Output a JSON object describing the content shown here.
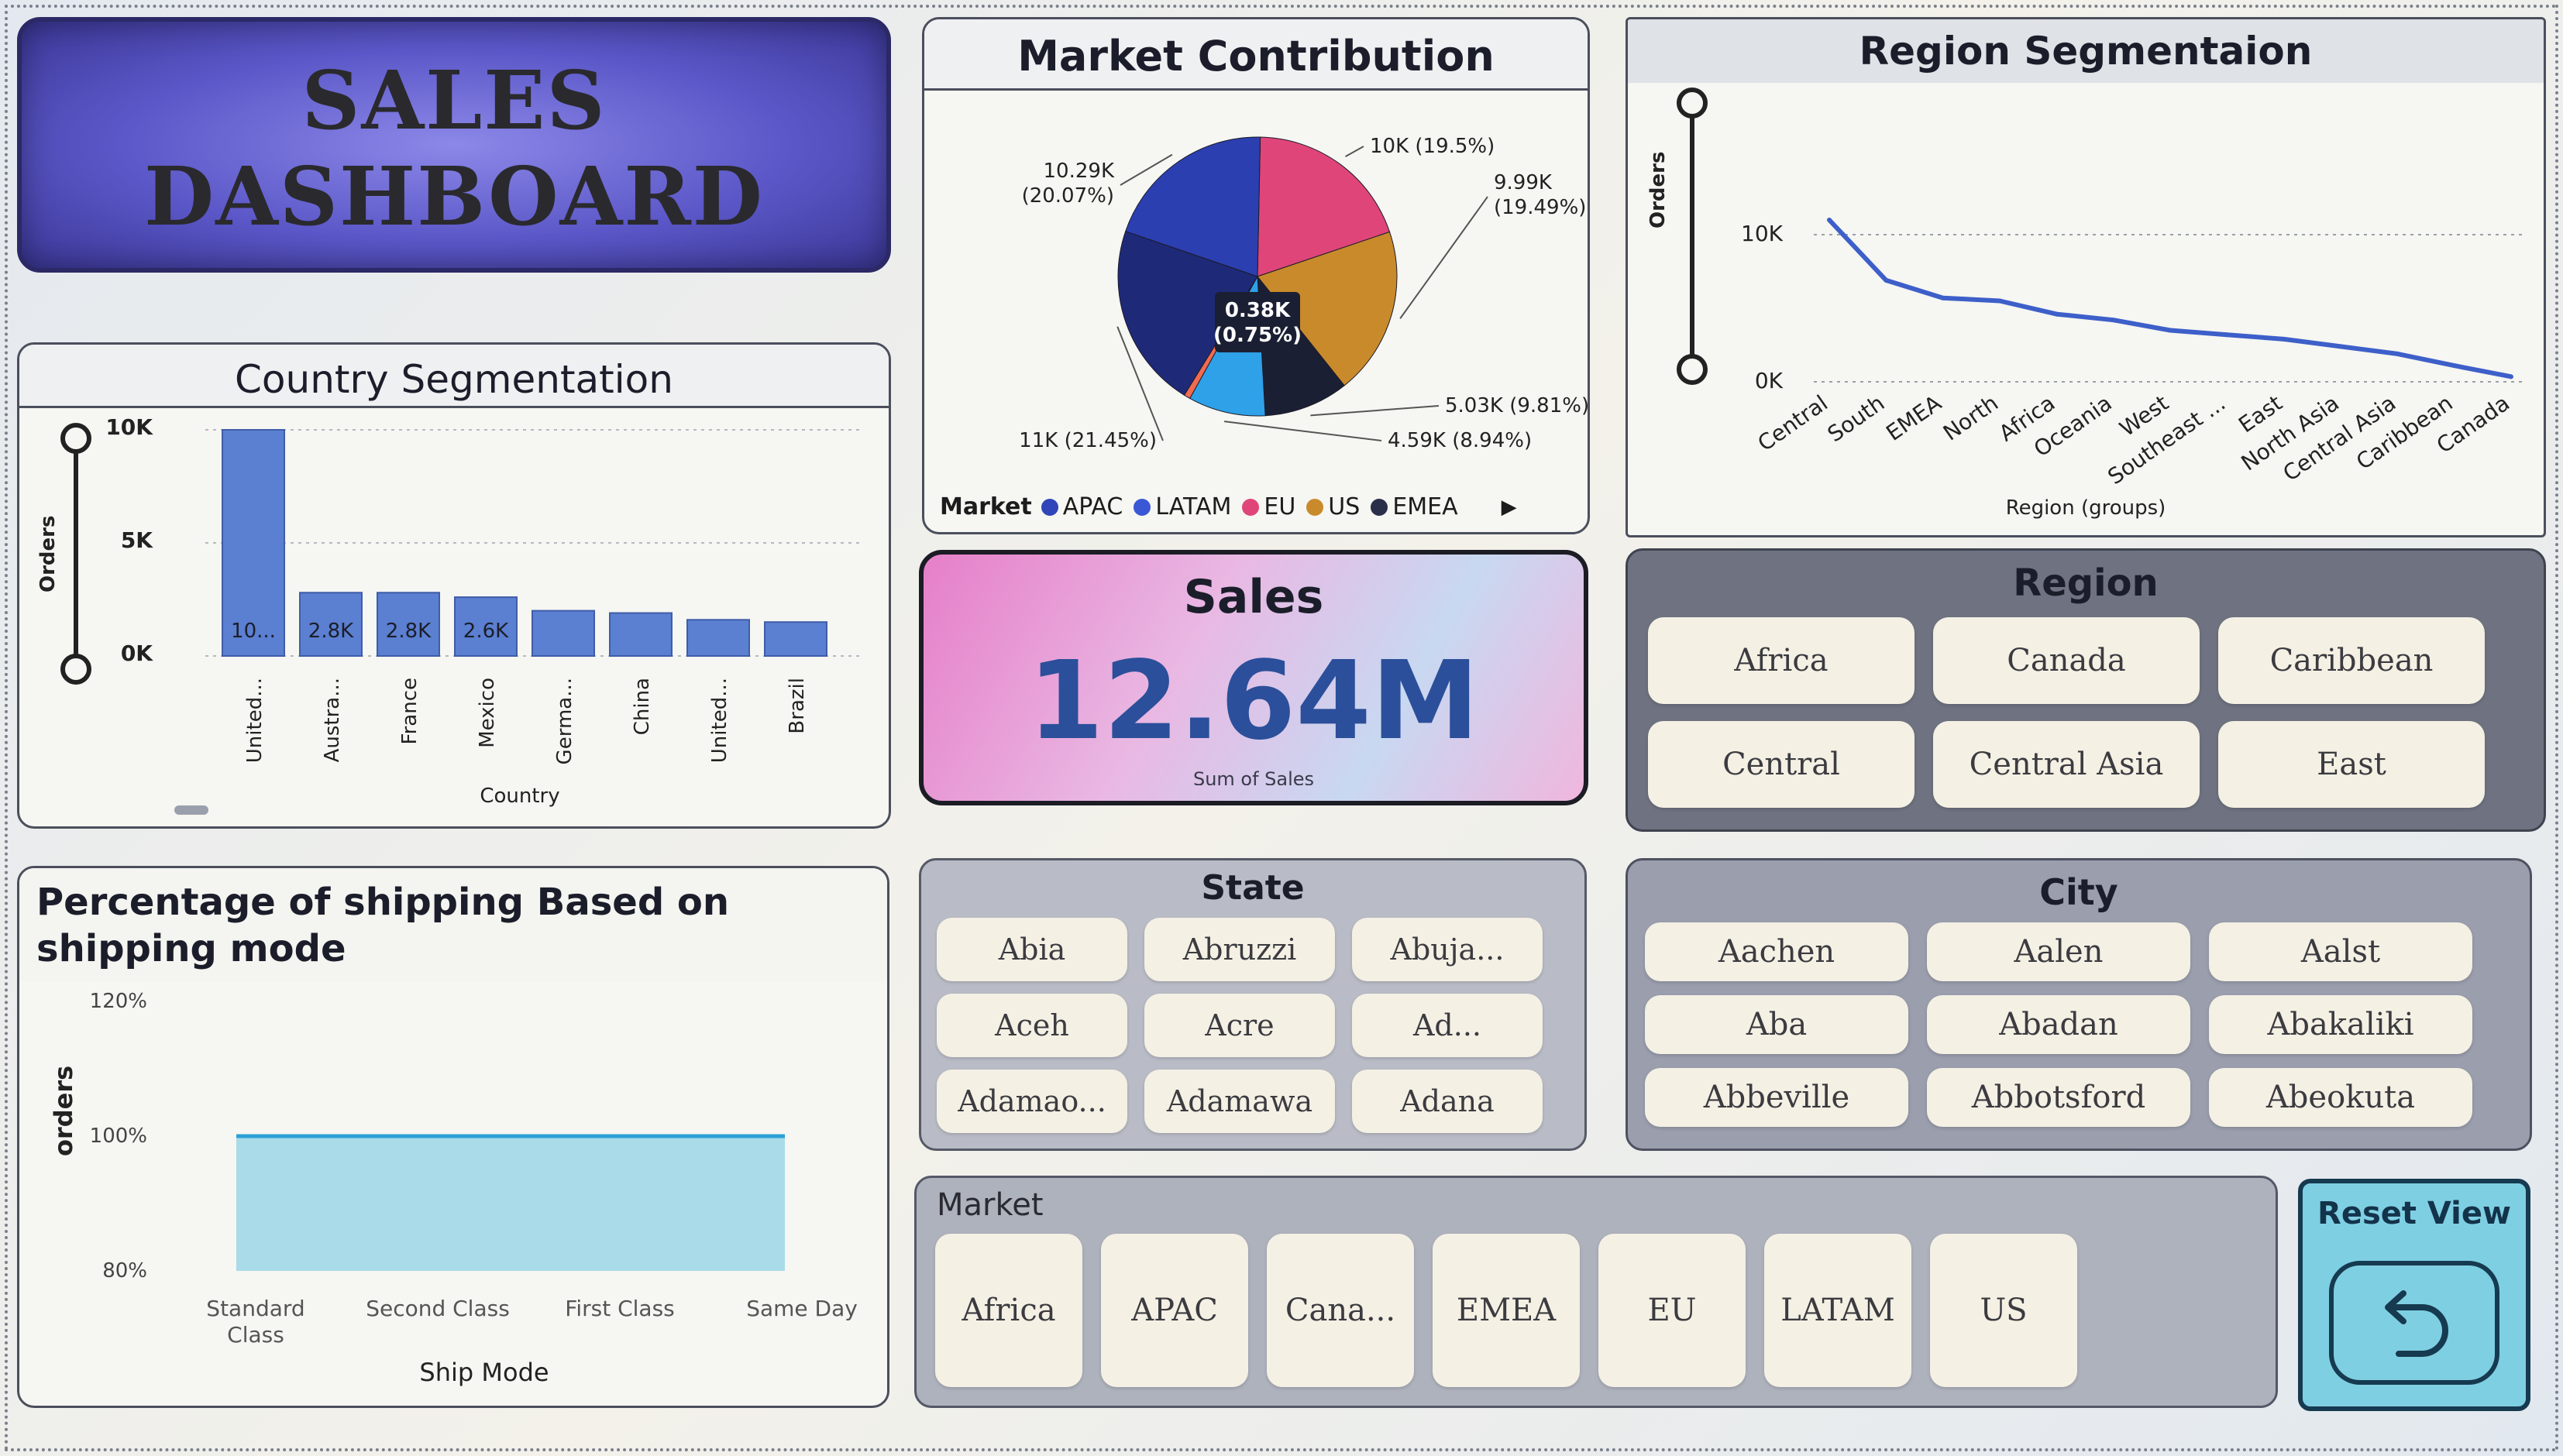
{
  "title": {
    "line1": "SALES",
    "line2": "DASHBOARD"
  },
  "market_contribution": {
    "title": "Market Contribution",
    "legend_title": "Market",
    "legend": [
      {
        "name": "APAC",
        "color": "#2f45b8"
      },
      {
        "name": "LATAM",
        "color": "#3a57d6"
      },
      {
        "name": "EU",
        "color": "#e0457a"
      },
      {
        "name": "US",
        "color": "#c98a2b"
      },
      {
        "name": "EMEA",
        "color": "#2a2f4a"
      }
    ],
    "slices": [
      {
        "label": "10K (19.5%)",
        "value": 10,
        "color": "#e0457a"
      },
      {
        "label": "9.99K (19.49%)",
        "value": 9.99,
        "color": "#c98a2b"
      },
      {
        "label": "5.03K (9.81%)",
        "value": 5.03,
        "color": "#1b1f33"
      },
      {
        "label": "4.59K (8.94%)",
        "value": 4.59,
        "color": "#2ea1e8"
      },
      {
        "label": "0.38K (0.75%)",
        "value": 0.38,
        "color": "#f26a4f"
      },
      {
        "label": "11K (21.45%)",
        "value": 11,
        "color": "#1e2a78"
      },
      {
        "label": "10.29K (20.07%)",
        "value": 10.29,
        "color": "#2b3fb0"
      }
    ],
    "center_label": "0.38K\n(0.75%)"
  },
  "region_segmentation": {
    "title": "Region Segmentaion",
    "ylabel": "Orders",
    "xlabel": "Region (groups)",
    "yticks": [
      "10K",
      "0K"
    ],
    "categories": [
      "Central",
      "South",
      "EMEA",
      "North",
      "Africa",
      "Oceania",
      "West",
      "Southeast ...",
      "East",
      "North Asia",
      "Central Asia",
      "Caribbean",
      "Canada"
    ],
    "values": [
      11000,
      6900,
      5700,
      5500,
      4600,
      4200,
      3500,
      3200,
      2900,
      2400,
      1900,
      1100,
      350
    ],
    "ylim": [
      0,
      12000
    ]
  },
  "country_segmentation": {
    "title": "Country Segmentation",
    "ylabel": "Orders",
    "xlabel": "Country",
    "yticks": [
      "10K",
      "5K",
      "0K"
    ],
    "categories": [
      "United...",
      "Austra...",
      "France",
      "Mexico",
      "Germa...",
      "China",
      "United...",
      "Brazil"
    ],
    "values": [
      10000,
      2800,
      2800,
      2600,
      2000,
      1900,
      1600,
      1500
    ],
    "data_labels": [
      "10...",
      "2.8K",
      "2.8K",
      "2.6K",
      "",
      "",
      "",
      ""
    ],
    "ylim": [
      0,
      10000
    ]
  },
  "sales_card": {
    "title": "Sales",
    "value": "12.64M",
    "caption": "Sum of Sales"
  },
  "shipping": {
    "title": "Percentage of shipping Based on shipping mode",
    "ylabel": "orders",
    "xlabel": "Ship Mode",
    "yticks": [
      "120%",
      "100%",
      "80%"
    ],
    "categories": [
      "Standard Class",
      "Second Class",
      "First Class",
      "Same Day"
    ],
    "values": [
      100,
      100,
      100,
      100
    ],
    "ylim": [
      80,
      120
    ]
  },
  "region_slicer": {
    "title": "Region",
    "items": [
      "Africa",
      "Canada",
      "Caribbean",
      "Central",
      "Central Asia",
      "East"
    ]
  },
  "state_slicer": {
    "title": "State",
    "items": [
      "Abia",
      "Abruzzi",
      "Abuja...",
      "Aceh",
      "Acre",
      "Ad...",
      "Adamao...",
      "Adamawa",
      "Adana"
    ]
  },
  "city_slicer": {
    "title": "City",
    "items": [
      "Aachen",
      "Aalen",
      "Aalst",
      "Aba",
      "Abadan",
      "Abakaliki",
      "Abbeville",
      "Abbotsford",
      "Abeokuta"
    ]
  },
  "market_slicer": {
    "title": "Market",
    "items": [
      "Africa",
      "APAC",
      "Cana...",
      "EMEA",
      "EU",
      "LATAM",
      "US"
    ]
  },
  "reset": {
    "label": "Reset View"
  },
  "colors": {
    "accent": "#4a6fd0",
    "line": "#3d5fc9",
    "area": "#a9dbe8"
  }
}
